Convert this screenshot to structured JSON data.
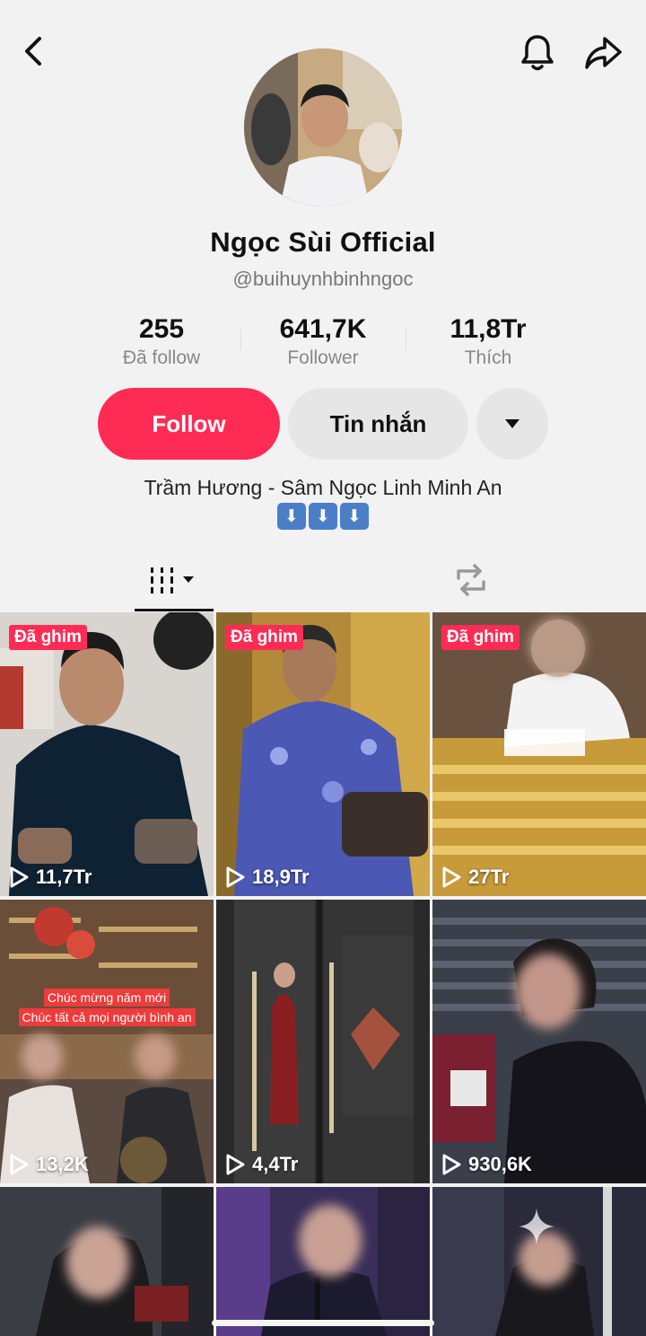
{
  "topbar": {
    "back_icon": "chevron-left-icon",
    "bell_icon": "bell-icon",
    "share_icon": "share-arrow-icon"
  },
  "profile": {
    "name": "Ngọc Sùi Official",
    "handle": "@buihuynhbinhngoc",
    "bio": "Trầm Hương - Sâm Ngọc Linh Minh An",
    "bio_emojis": [
      "⬇",
      "⬇",
      "⬇"
    ]
  },
  "stats": [
    {
      "value": "255",
      "label": "Đã follow"
    },
    {
      "value": "641,7K",
      "label": "Follower"
    },
    {
      "value": "11,8Tr",
      "label": "Thích"
    }
  ],
  "actions": {
    "follow": "Follow",
    "message": "Tin nhắn",
    "more_icon": "caret-down-icon"
  },
  "tabs": {
    "videos_icon": "grid-bars-icon",
    "reposts_icon": "repost-icon"
  },
  "videos": [
    {
      "pinned": "Đã ghim",
      "views": "11,7Tr"
    },
    {
      "pinned": "Đã ghim",
      "views": "18,9Tr"
    },
    {
      "pinned": "Đã ghim",
      "views": "27Tr"
    },
    {
      "views": "13,2K",
      "caption_lines": [
        "Chúc mừng năm mới",
        "Chúc tất cả mọi người bình an"
      ]
    },
    {
      "views": "4,4Tr"
    },
    {
      "views": "930,6K"
    },
    {},
    {},
    {}
  ],
  "colors": {
    "accent": "#fe2c55",
    "background": "#f2f2f2",
    "secondary_button": "#e6e6e6"
  }
}
